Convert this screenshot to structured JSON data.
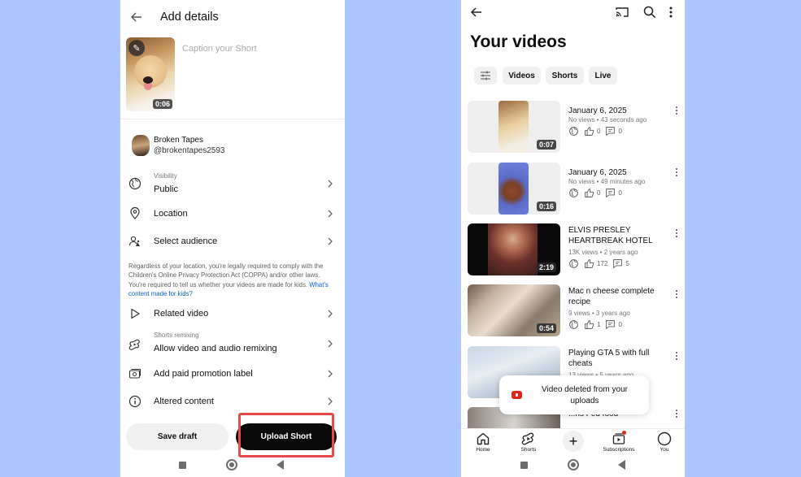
{
  "left": {
    "header": {
      "title": "Add details",
      "back_icon": "back-arrow-icon"
    },
    "caption": {
      "placeholder": "Caption your Short",
      "value": ""
    },
    "thumbnail": {
      "duration": "0:06",
      "edit_icon": "pencil-icon"
    },
    "account": {
      "name": "Broken Tapes",
      "handle": "@brokentapes2593"
    },
    "settings": [
      {
        "icon": "globe-icon",
        "sublabel": "Visibility",
        "label": "Public"
      },
      {
        "icon": "location-pin-icon",
        "label": "Location"
      },
      {
        "icon": "audience-icon",
        "label": "Select audience"
      },
      {
        "icon": "play-outline-icon",
        "label": "Related video"
      },
      {
        "icon": "shorts-remix-icon",
        "sublabel": "Shorts remixing",
        "label": "Allow video and audio remixing"
      },
      {
        "icon": "paid-promotion-icon",
        "label": "Add paid promotion label"
      },
      {
        "icon": "info-icon",
        "label": "Altered content"
      }
    ],
    "coppa": {
      "text": "Regardless of your location, you're legally required to comply with the Children's Online Privacy Protection Act (COPPA) and/or other laws. You're required to tell us whether your videos are made for kids. ",
      "link": "What's content made for kids?"
    },
    "buttons": {
      "save_draft": "Save draft",
      "upload": "Upload Short"
    },
    "highlight_color": "#e9474a"
  },
  "right": {
    "header": {
      "title": "Your videos",
      "icons": [
        "back-arrow-icon",
        "cast-icon",
        "search-icon",
        "more-vert-icon"
      ]
    },
    "chips": [
      "Videos",
      "Shorts",
      "Live"
    ],
    "videos": [
      {
        "title": "January 6, 2025",
        "meta": "No views • 43 seconds ago",
        "likes": "0",
        "comments": "0",
        "duration": "0:07"
      },
      {
        "title": "January 6, 2025",
        "meta": "No views • 49 minutes ago",
        "likes": "0",
        "comments": "0",
        "duration": "0:16"
      },
      {
        "title": "ELVIS PRESLEY HEARTBREAK HOTEL",
        "meta": "13K views • 2 years ago",
        "likes": "172",
        "comments": "5",
        "duration": "2:19"
      },
      {
        "title": "Mac n cheese complete recipe",
        "meta": "9 views • 3 years ago",
        "likes": "1",
        "comments": "0",
        "duration": "0:54"
      },
      {
        "title": "Playing GTA 5 with full cheats",
        "meta": "13 views • 5 years ago",
        "likes": "",
        "comments": "",
        "duration": ""
      },
      {
        "title": "...ns Fed food",
        "meta": "",
        "likes": "",
        "comments": "",
        "duration": ""
      }
    ],
    "toast": {
      "text": "Video deleted from your uploads"
    },
    "bottom_nav": [
      {
        "label": "Home",
        "icon": "home-icon"
      },
      {
        "label": "Shorts",
        "icon": "shorts-icon"
      },
      {
        "label": "",
        "icon": "create-plus-icon"
      },
      {
        "label": "Subscriptions",
        "icon": "subscriptions-icon"
      },
      {
        "label": "You",
        "icon": "profile-circle-icon"
      }
    ],
    "create_symbol": "+"
  },
  "colors": {
    "background": "#aec6ff",
    "youtube_red": "#e62117",
    "link_blue": "#065fd4"
  }
}
